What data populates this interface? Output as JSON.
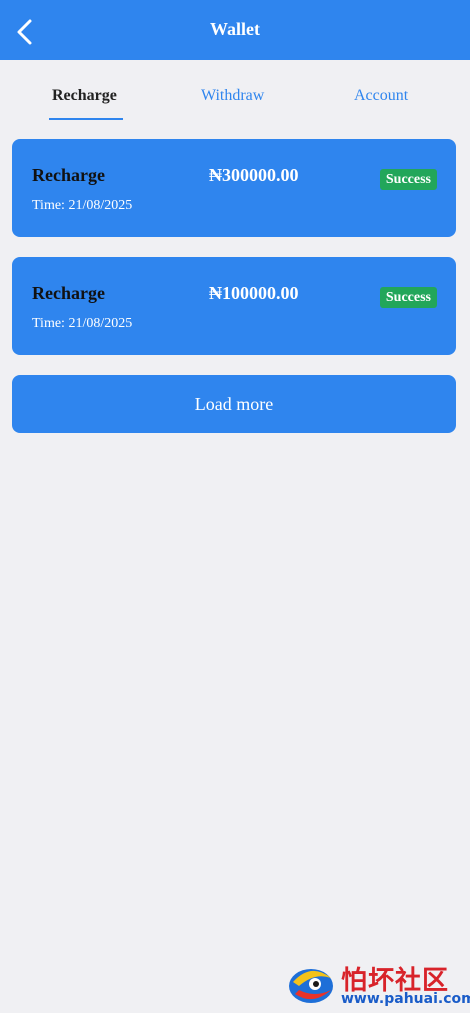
{
  "header": {
    "title": "Wallet"
  },
  "tabs": [
    {
      "label": "Recharge",
      "active": true
    },
    {
      "label": "Withdraw",
      "active": false
    },
    {
      "label": "Account",
      "active": false
    }
  ],
  "records": [
    {
      "type": "Recharge",
      "amount": "₦300000.00",
      "time": "Time: 21/08/2025",
      "status": "Success"
    },
    {
      "type": "Recharge",
      "amount": "₦100000.00",
      "time": "Time: 21/08/2025",
      "status": "Success"
    }
  ],
  "load_more_label": "Load more",
  "watermark": {
    "text": "怕坏社区",
    "url": "www.pahuai.com"
  },
  "colors": {
    "accent": "#2f85ee",
    "background": "#f0f0f3",
    "success": "#22a65a"
  }
}
